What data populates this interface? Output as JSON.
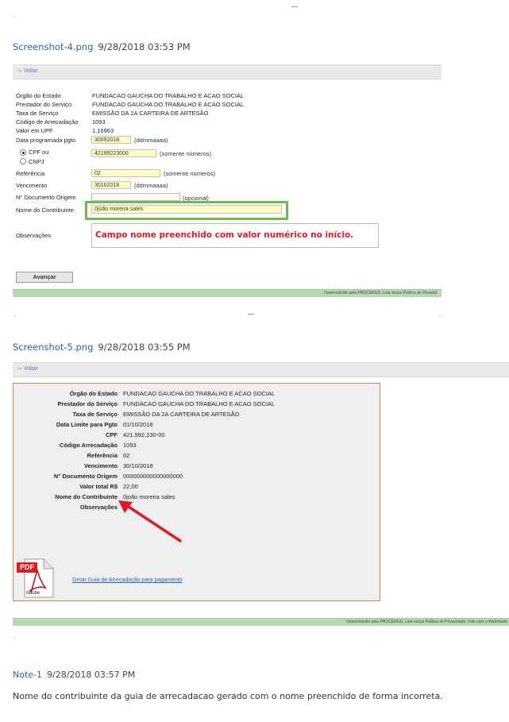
{
  "screenshot1": {
    "filename": "Screenshot-4.png",
    "date": "9/28/2018 03:53 PM",
    "back_label": "Voltar",
    "fields": [
      {
        "label": "Órgão do Estado",
        "value": "FUNDACAO GAUCHA DO TRABALHO E ACAO SOCIAL"
      },
      {
        "label": "Prestador do Serviço",
        "value": "FUNDACAO GAUCHA DO TRABALHO E ACAO SOCIAL"
      },
      {
        "label": "Taxa de Serviço",
        "value": "EMISSÃO DA 2A CARTEIRA DE ARTESÃO"
      },
      {
        "label": "Código de Arrecadação",
        "value": "1093"
      },
      {
        "label": "Valor em UPF",
        "value": "1,16963"
      }
    ],
    "data_prog": {
      "label": "Data programada pgto",
      "value": "30092018",
      "hint": "(ddmmaaaa)"
    },
    "cpf_label": "CPF ou",
    "cnpj_label": "CNPJ",
    "cpf_value": "42199223000",
    "cpf_hint": "(somente números)",
    "referencia": {
      "label": "Referência",
      "value": "02",
      "hint": "(somente números)"
    },
    "vencimento": {
      "label": "Vencimento",
      "value": "30102018",
      "hint": "(ddmmaaaa)"
    },
    "documento": {
      "label": "N° Documento Origem",
      "value": "",
      "hint": "(opcional)"
    },
    "contribuinte": {
      "label": "Nome do Contribuinte",
      "value": "0joão moreira sales"
    },
    "observacoes_label": "Observações",
    "annotation": "Campo nome preenchido com valor numérico no início.",
    "submit_label": "Avançar",
    "footer": "Desenvolvido pela PROCERGS. Leia nossa Política de Privacid"
  },
  "screenshot2": {
    "filename": "Screenshot-5.png",
    "date": "9/28/2018 03:55 PM",
    "back_label": "Voltar",
    "rows": [
      {
        "label": "Órgão do Estado",
        "value": "FUNDACAO GAUCHA DO TRABALHO E ACAO SOCIAL"
      },
      {
        "label": "Prestador do Serviço",
        "value": "FUNDACAO GAUCHA DO TRABALHO E ACAO SOCIAL"
      },
      {
        "label": "Taxa de Serviço",
        "value": "EMISSÃO DA 2A CARTEIRA DE ARTESÃO"
      },
      {
        "label": "Data Limite para Pgto",
        "value": "01/10/2018"
      },
      {
        "label": "CPF",
        "value": "421.992.230-00"
      },
      {
        "label": "Código Arrecadação",
        "value": "1093"
      },
      {
        "label": "Referência",
        "value": "02"
      },
      {
        "label": "Vencimento",
        "value": "30/10/2018"
      },
      {
        "label": "N° Documento Origem",
        "value": "000000000000000000"
      },
      {
        "label": "Valor total R$",
        "value": "22,00"
      },
      {
        "label": "Nome do Contribuinte",
        "value": "0joão moreira sales"
      },
      {
        "label": "Observações",
        "value": ""
      }
    ],
    "pdf_label": "PDF",
    "adobe_label": "Adobe",
    "gerar_link": "Gerar Guia de Arrecadação para pagamento",
    "footer": "Desenvolvido pela PROCERGS. Leia nossa Política de Privacidade. Fale com o Webmaste"
  },
  "note": {
    "title": "Note-1",
    "date": "9/28/2018 03:57 PM",
    "text": "Nome do contribuinte da guia de arrecadacao gerado com o nome preenchido de forma incorreta."
  },
  "colors": {
    "green_frame": "#6dbb4e",
    "annotation_red": "#e0192a",
    "link_blue": "#2b62a8"
  }
}
